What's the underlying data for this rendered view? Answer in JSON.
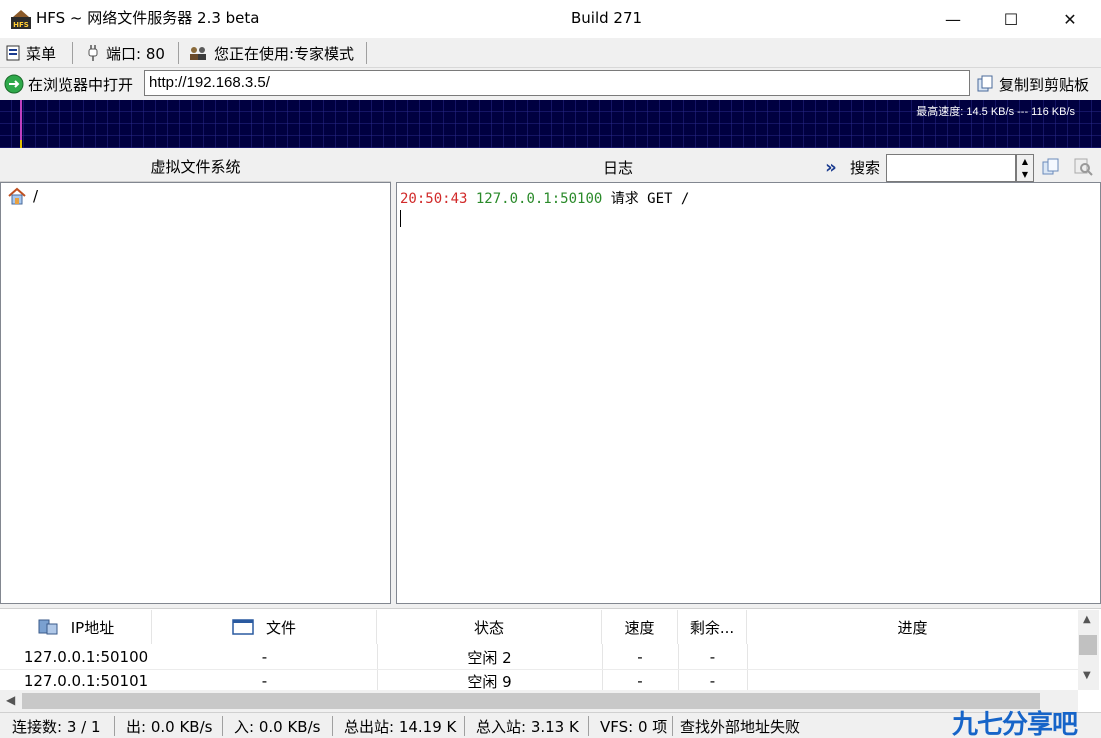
{
  "window": {
    "title": "HFS ~ 网络文件服务器 2.3 beta",
    "build": "Build 271",
    "minimize": "—",
    "maximize": "☐",
    "close": "✕"
  },
  "toolbar": {
    "menu": "菜单",
    "port": "端口: 80",
    "mode": "您正在使用:专家模式"
  },
  "urlbar": {
    "open_in_browser": "在浏览器中打开",
    "url": "http://192.168.3.5/",
    "copy_to_clipboard": "复制到剪贴板"
  },
  "graph": {
    "label": "最高速度: 14.5 KB/s --- 116 KB/s"
  },
  "vfs": {
    "header": "虚拟文件系统",
    "root": "/"
  },
  "log": {
    "header": "日志",
    "expand": "»",
    "search_label": "搜索",
    "entries": [
      {
        "time": "20:50:43",
        "address": "127.0.0.1:50100",
        "message": "请求 GET /"
      }
    ]
  },
  "connections": {
    "columns": [
      "IP地址",
      "文件",
      "状态",
      "速度",
      "剩余...",
      "进度"
    ],
    "rows": [
      [
        "127.0.0.1:50100",
        "-",
        "空闲 2",
        "-",
        "-",
        ""
      ],
      [
        "127.0.0.1:50101",
        "-",
        "空闲 9",
        "-",
        "-",
        ""
      ]
    ]
  },
  "statusbar": {
    "connections": "连接数: 3 / 1",
    "out": "出: 0.0 KB/s",
    "in": "入: 0.0 KB/s",
    "total_out": "总出站: 14.19 K",
    "total_in": "总入站: 3.13 K",
    "vfs": "VFS: 0 项",
    "external": "查找外部地址失败"
  },
  "watermark": "九七分享吧",
  "colors": {
    "graph_bg": "#000040",
    "graph_grid": "#2a2a8a",
    "log_time": "#d12a2a",
    "log_ip": "#2a8a2a",
    "watermark": "#1664c8"
  }
}
